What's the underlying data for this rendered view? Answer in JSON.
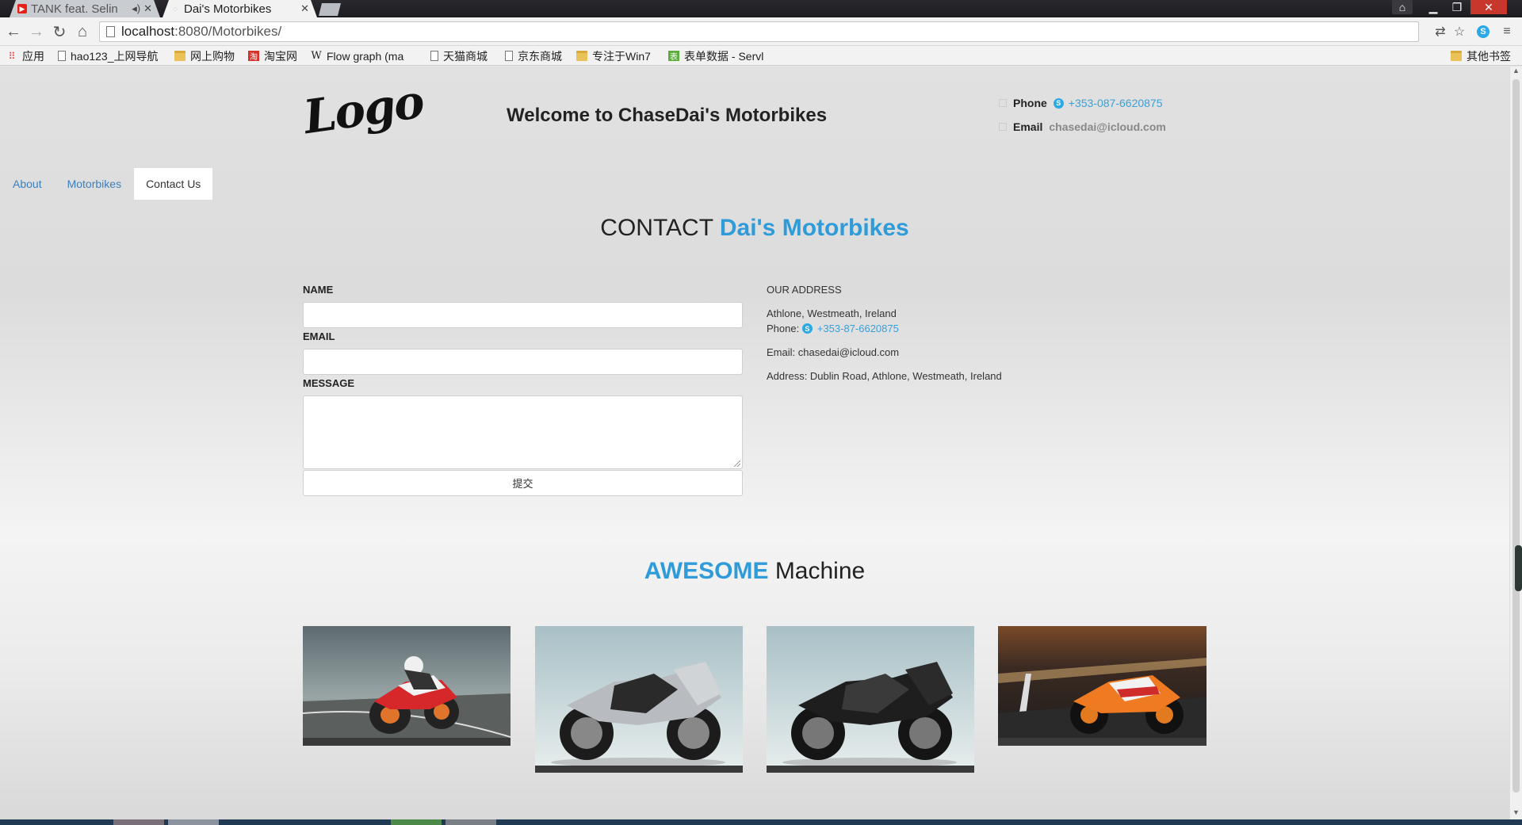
{
  "browser": {
    "tabs": [
      {
        "title": "TANK feat. Selin",
        "icon": "youtube-icon",
        "audio": true
      },
      {
        "title": "Dai's Motorbikes",
        "icon": "loading-icon",
        "active": true
      }
    ],
    "url_host": "localhost",
    "url_rest": ":8080/Motorbikes/",
    "bookmarks": [
      {
        "label": "应用",
        "icon": "apps-icon"
      },
      {
        "label": "hao123_上网导航",
        "icon": "doc-icon"
      },
      {
        "label": "网上购物",
        "icon": "folder-icon"
      },
      {
        "label": "淘宝网",
        "icon": "taobao-icon"
      },
      {
        "label": "Flow graph (ma",
        "icon": "wikipedia-icon"
      },
      {
        "label": "天猫商城",
        "icon": "doc-icon"
      },
      {
        "label": "京东商城",
        "icon": "doc-icon"
      },
      {
        "label": "专注于Win7",
        "icon": "folder-icon"
      },
      {
        "label": "表单数据 - Servl",
        "icon": "form-icon"
      },
      {
        "label": "其他书签",
        "icon": "folder-icon"
      }
    ]
  },
  "header": {
    "logo_text": "Logo",
    "site_title": "Welcome to ChaseDai's Motorbikes",
    "phone_label": "Phone",
    "phone_value": "+353-087-6620875",
    "email_label": "Email",
    "email_value": "chasedai@icloud.com"
  },
  "nav": {
    "items": [
      "About",
      "Motorbikes",
      "Contact Us"
    ],
    "active": "Contact Us"
  },
  "contact": {
    "title_plain": "CONTACT",
    "title_blue": "Dai's Motorbikes",
    "name_label": "NAME",
    "email_label": "EMAIL",
    "message_label": "MESSAGE",
    "submit_label": "提交",
    "address_heading": "OUR ADDRESS",
    "address_line": "Athlone, Westmeath, Ireland",
    "phone_prefix": "Phone:",
    "phone_value": "+353-87-6620875",
    "email_line": "Email: chasedai@icloud.com",
    "address_full": "Address: Dublin Road, Athlone, Westmeath, Ireland"
  },
  "gallery": {
    "title_blue": "AWESOME",
    "title_plain": "Machine",
    "images": [
      {
        "name": "motorbike-image-1",
        "subject": "red racing motorbike on road"
      },
      {
        "name": "motorbike-image-2",
        "subject": "silver sport motorbike"
      },
      {
        "name": "motorbike-image-3",
        "subject": "black sport motorbike"
      },
      {
        "name": "motorbike-image-4",
        "subject": "Repsol racing motorbike"
      }
    ]
  },
  "colors": {
    "accent": "#2f9bd9",
    "link": "#3a7fc0",
    "text": "#222222"
  }
}
